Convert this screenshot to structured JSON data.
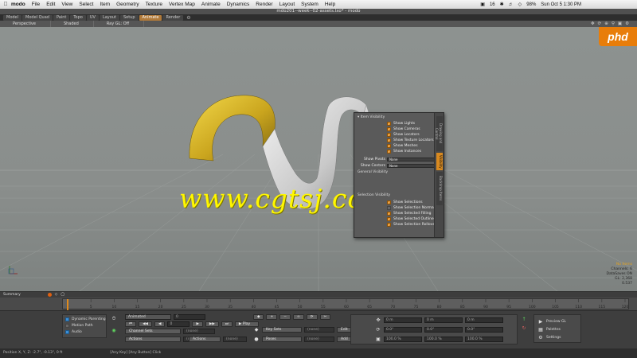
{
  "menubar": {
    "app": "modo",
    "items": [
      "File",
      "Edit",
      "View",
      "Select",
      "Item",
      "Geometry",
      "Texture",
      "Vertex Map",
      "Animate",
      "Dynamics",
      "Render",
      "Layout",
      "System",
      "Help"
    ],
    "status_num": "16",
    "battery": "98%",
    "clock": "Sun Oct 5  1:30 PM"
  },
  "window": {
    "title": "mdo201--week--02-assets.lxo* - modo"
  },
  "layout_tabs": {
    "tabs": [
      "Model",
      "Model Quad",
      "Paint",
      "Topo",
      "UV",
      "Layout",
      "Setup",
      "Animate",
      "Render"
    ],
    "active": "Animate"
  },
  "viewport": {
    "view_label": "Perspective",
    "shading_label": "Shaded",
    "gl_label": "Ray GL: Off",
    "icons": [
      "move-icon",
      "rotate-icon",
      "zoom-icon",
      "search-icon",
      "maximize-icon",
      "gear-icon"
    ]
  },
  "watermark": {
    "text": "www.cgtsj.com",
    "badge": "phd"
  },
  "stats": {
    "lines": [
      "No Items",
      "Channels: 6",
      "DataSaves ON",
      "GL: 2,368",
      "0.537"
    ]
  },
  "popup": {
    "item_visibility_header": "Item Visibility",
    "item_rows": [
      {
        "label": "Show Lights",
        "checked": true
      },
      {
        "label": "Show Cameras",
        "checked": true
      },
      {
        "label": "Show Locators",
        "checked": true
      },
      {
        "label": "Show Texture Locators",
        "checked": true
      },
      {
        "label": "Show Meshes",
        "checked": true
      },
      {
        "label": "Show Instances",
        "checked": true
      }
    ],
    "show_pivots_label": "Show Pivots",
    "show_pivots_value": "None",
    "show_centers_label": "Show Centers",
    "show_centers_value": "None",
    "general_visibility_header": "General Visibility",
    "selection_visibility_header": "Selection Visibility",
    "selection_rows": [
      {
        "label": "Show Selections",
        "checked": true
      },
      {
        "label": "Show Selection Normals",
        "checked": false
      },
      {
        "label": "Show Selected Filling",
        "checked": true
      },
      {
        "label": "Show Selected Outline",
        "checked": true
      },
      {
        "label": "Show Selection Rollovers",
        "checked": true
      }
    ],
    "side_tabs": [
      "Drawing and Control",
      "Visibility",
      "Backdrop Items"
    ],
    "active_side_tab": "Visibility"
  },
  "timeline": {
    "label": "Summary",
    "ticks": [
      "0",
      "5",
      "10",
      "15",
      "20",
      "25",
      "30",
      "35",
      "40",
      "45",
      "50",
      "55",
      "60",
      "65",
      "70",
      "75",
      "80",
      "85",
      "90",
      "95",
      "100",
      "105",
      "110",
      "115",
      "120"
    ]
  },
  "controls": {
    "toggles": [
      "Dynamic Parenting",
      "Motion Path",
      "Audio"
    ],
    "mode_dropdown": "Animated",
    "play_label": "Play",
    "frame_value": "0",
    "channel_sets_label": "Channel Sets",
    "channel_sets_value": "(none)",
    "actions_label": "Actions",
    "actions_value": "(none)",
    "key_sets_label": "Key Sets",
    "key_sets_value": "(none)",
    "poses_label": "Poses",
    "poses_value": "(none)",
    "edit_label": "Edit",
    "add_label": "Add",
    "xyz_fields": [
      [
        "0 m",
        "0 m",
        "0 m"
      ],
      [
        "0.0°",
        "0.0°",
        "0.0°"
      ],
      [
        "100.0 %",
        "100.0 %",
        "100.0 %"
      ]
    ],
    "preview_label": "Preview GL",
    "palettes_label": "Palettes",
    "settings_label": "Settings"
  },
  "statusbar": {
    "position": "Position X, Y, Z:  -2.7\", -0.13\", 0 ft",
    "hint": "[Any Key]  [Any Button]  Click",
    "action": "Click"
  }
}
